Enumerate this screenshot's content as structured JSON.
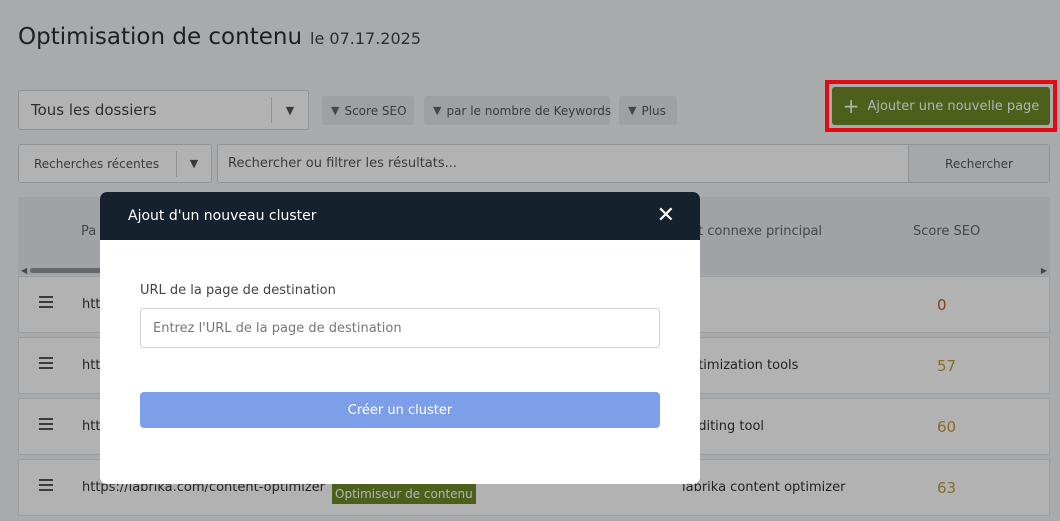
{
  "header": {
    "title": "Optimisation de contenu",
    "date": "le 07.17.2025"
  },
  "toolbar": {
    "folder_select": "Tous les dossiers",
    "filters": [
      "Score SEO",
      "par le nombre de Keywords",
      "Plus"
    ],
    "add_button": "Ajouter une nouvelle page",
    "recent_searches": "Recherches récentes",
    "search_placeholder": "Rechercher ou filtrer les résultats...",
    "search_button": "Rechercher"
  },
  "table": {
    "columns": [
      "Pa",
      "et connexe principal",
      "Score SEO"
    ],
    "rows": [
      {
        "url": "htt",
        "tag": "",
        "keyword": "",
        "score": "0"
      },
      {
        "url": "htt",
        "tag": "",
        "keyword": "optimization tools",
        "score": "57"
      },
      {
        "url": "htt",
        "tag": "",
        "keyword": "auditing tool",
        "score": "60"
      },
      {
        "url": "https://labrika.com/content-optimizer",
        "tag": "Optimiseur de contenu",
        "keyword": "labrika content optimizer",
        "score": "63"
      }
    ]
  },
  "modal": {
    "title": "Ajout d'un nouveau cluster",
    "field_label": "URL de la page de destination",
    "field_placeholder": "Entrez l'URL de la page de destination",
    "field_value": "",
    "submit": "Créer un cluster"
  },
  "colors": {
    "accent_green": "#6e8a28",
    "highlight_red": "#e30b13",
    "modal_header": "#15222e",
    "create_button": "#7d9ee9",
    "score_zero": "#c0621e",
    "score_mid": "#c49a3c"
  },
  "icons": [
    "chevron-down-icon",
    "filter-icon",
    "plus-icon",
    "close-icon",
    "drag-handle-icon"
  ]
}
